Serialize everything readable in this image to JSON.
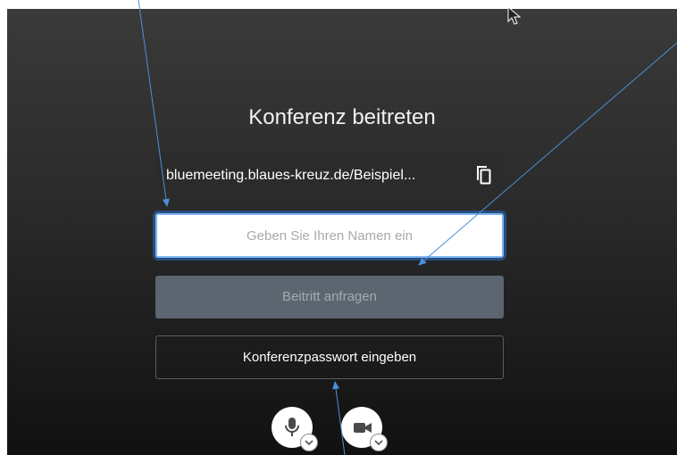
{
  "dialog": {
    "title": "Konferenz beitreten",
    "meeting_url": "bluemeeting.blaues-kreuz.de/Beispiel...",
    "name_placeholder": "Geben Sie Ihren Namen ein",
    "join_label": "Beitritt anfragen",
    "password_label": "Konferenzpasswort eingeben"
  },
  "icons": {
    "copy": "copy-icon",
    "mic": "microphone-icon",
    "camera": "video-camera-icon",
    "chevron": "chevron-down-icon",
    "cursor": "mouse-cursor-icon"
  },
  "colors": {
    "panel_bg": "#2a2a2a",
    "join_button": "#5b6670",
    "input_focus": "#7fb6f0",
    "annotation_arrows": "#4a90d9"
  }
}
